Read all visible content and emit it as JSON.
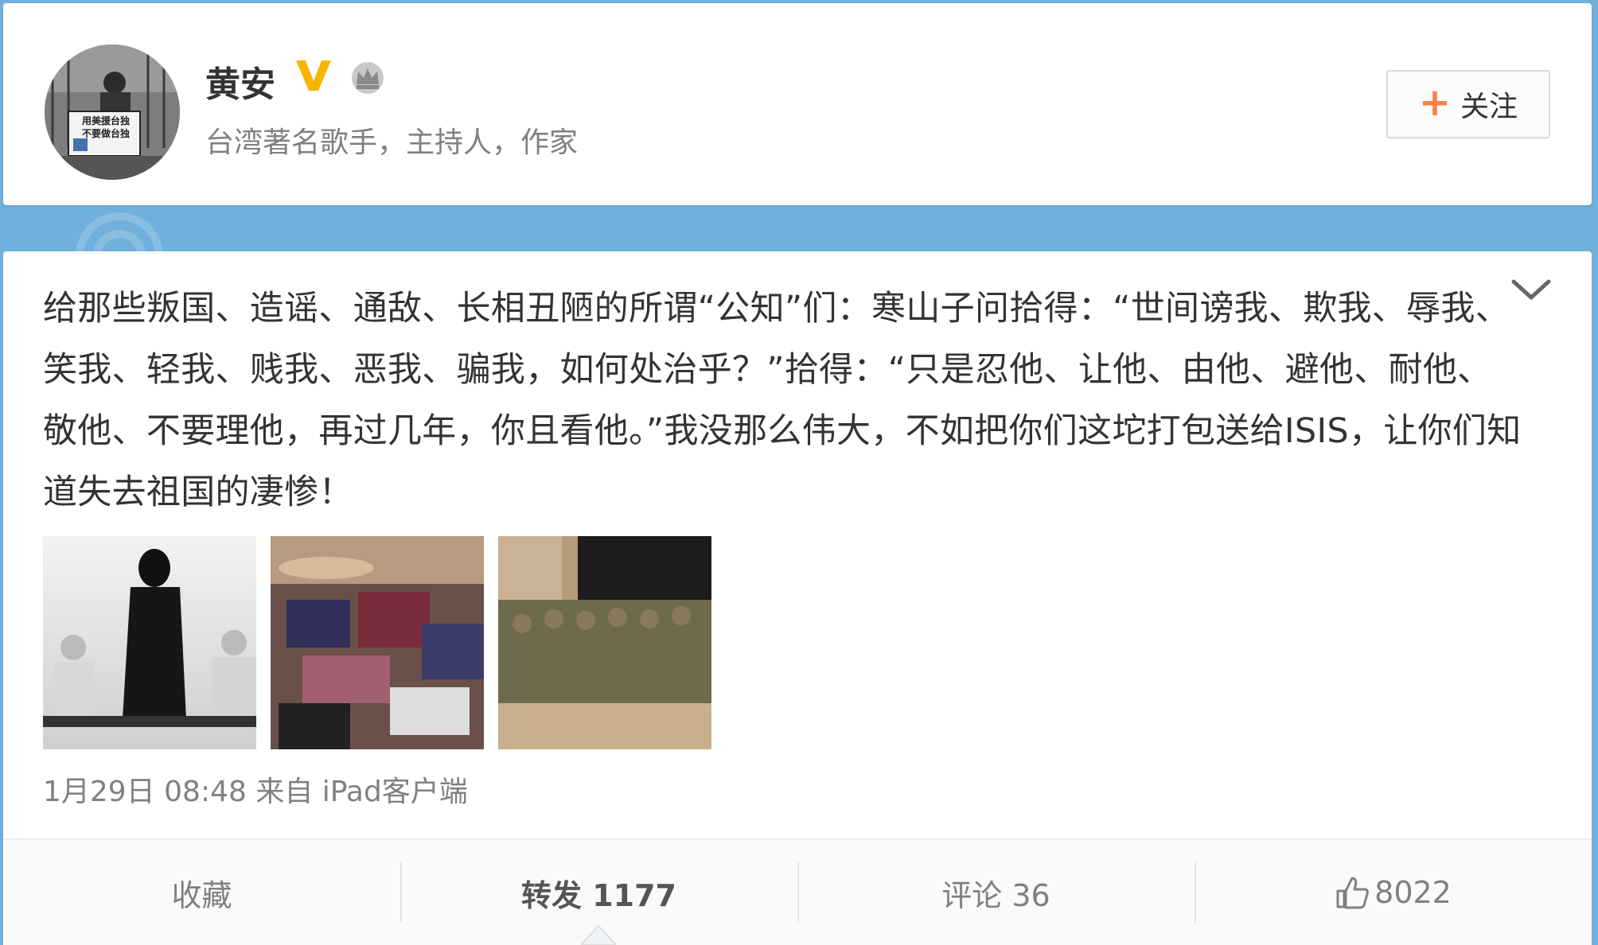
{
  "profile": {
    "name": "黄安",
    "bio": "台湾著名歌手，主持人，作家",
    "follow_label": "关注",
    "follow_symbol": "+",
    "verified_icon": "verified-v-icon",
    "member_icon": "crown-icon",
    "avatar_sign_lines": [
      "用美援台独",
      "不要做台独"
    ]
  },
  "post": {
    "text": "给那些叛国、造谣、通敌、长相丑陋的所谓“公知”们：寒山子问拾得：“世间谤我、欺我、辱我、笑我、轻我、贱我、恶我、骗我，如何处治乎？”拾得：“只是忍他、让他、由他、避他、耐他、敬他、不要理他，再过几年，你且看他。”我没那么伟大，不如把你们这坨打包送给ISIS，让你们知道失去祖国的凄惨！",
    "meta": "1月29日 08:48 来自 iPad客户端",
    "images": [
      "image-1",
      "image-2",
      "image-3"
    ]
  },
  "actions": {
    "favorite": "收藏",
    "repost": "转发 1177",
    "comment": "评论 36",
    "like": "8022"
  },
  "colors": {
    "background": "#6fb0dd",
    "accent": "#ff8140",
    "verified": "#f7b500"
  }
}
